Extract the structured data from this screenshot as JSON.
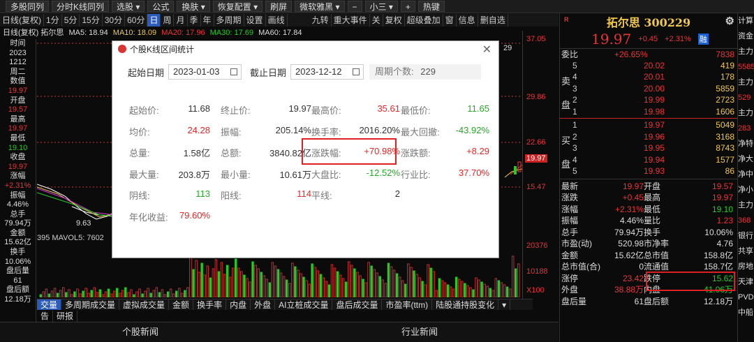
{
  "toolbar": {
    "items": [
      "多股同列",
      "分时K线同列",
      "选股 ▾",
      "公式",
      "换肤 ▾",
      "恢复配置 ▾",
      "刷屏",
      "微软雅黑 ▾",
      "−",
      "小三 ▾",
      "+",
      "热键"
    ]
  },
  "periods": {
    "items": [
      "日线(复权)",
      "1分",
      "5分",
      "15分",
      "30分",
      "60分",
      "日",
      "周",
      "月",
      "季",
      "年",
      "多周期",
      "设置",
      "画线",
      "九转",
      "重大事件",
      "关",
      "复权",
      "超级叠加",
      "窗",
      "信息",
      "删自选"
    ]
  },
  "ma_line": {
    "prefix": "日线(复权) 拓尔思",
    "ma5": "MA5: 18.94",
    "ma10": "MA10: 18.09",
    "ma20": "MA20: 17.96",
    "ma30": "MA30: 17.69",
    "ma60": "MA60: 17.84"
  },
  "left_panel": [
    {
      "t": "时间",
      "c": "#ddd"
    },
    {
      "t": "2023",
      "c": "#ddd"
    },
    {
      "t": "1212",
      "c": "#ddd"
    },
    {
      "t": "周二",
      "c": "#ddd"
    },
    {
      "t": "数值",
      "c": "#ddd"
    },
    {
      "t": "19.97",
      "c": "#e33"
    },
    {
      "t": "开盘",
      "c": "#ddd"
    },
    {
      "t": "19.57",
      "c": "#e33"
    },
    {
      "t": "最高",
      "c": "#ddd"
    },
    {
      "t": "19.97",
      "c": "#e33"
    },
    {
      "t": "最低",
      "c": "#ddd"
    },
    {
      "t": "19.10",
      "c": "#2c2"
    },
    {
      "t": "收盘",
      "c": "#ddd"
    },
    {
      "t": "19.97",
      "c": "#e33"
    },
    {
      "t": "涨幅",
      "c": "#ddd"
    },
    {
      "t": "+2.31%",
      "c": "#e33"
    },
    {
      "t": "振幅",
      "c": "#ddd"
    },
    {
      "t": "4.46%",
      "c": "#ddd"
    },
    {
      "t": "总手",
      "c": "#ddd"
    },
    {
      "t": "79.94万",
      "c": "#ddd"
    },
    {
      "t": "金额",
      "c": "#ddd"
    },
    {
      "t": "15.62亿",
      "c": "#ddd"
    },
    {
      "t": "换手",
      "c": "#ddd"
    },
    {
      "t": "10.06%",
      "c": "#ddd"
    },
    {
      "t": "盘后量",
      "c": "#ddd"
    },
    {
      "t": "61",
      "c": "#ddd"
    },
    {
      "t": "盘后额",
      "c": "#ddd"
    },
    {
      "t": "12.18万",
      "c": "#ddd"
    }
  ],
  "chart": {
    "low_label": "9.63",
    "mavol_label": "395  MAVOL5: 7602",
    "right_tag": "29",
    "price_tag": "19.97"
  },
  "scale": {
    "price": [
      "37.05",
      "29.86",
      "22.66",
      "15.47"
    ],
    "volume": [
      "20376",
      "10188",
      "X100"
    ]
  },
  "bottom_tabs": [
    "交量",
    "多周期成交量",
    "虚拟成交量",
    "金额",
    "换手率",
    "内盘",
    "外盘",
    "AI立桩成交量",
    "盘后成交量",
    "市盈率(ttm)",
    "陆股通持股变化",
    "▾"
  ],
  "bottom_tabs2": [
    "告",
    "研报"
  ],
  "news": {
    "left": "个股新闻",
    "right": "行业新闻"
  },
  "quote": {
    "title": "拓尔思 300229",
    "price": "19.97",
    "change": "+0.45",
    "pct": "+2.31%",
    "badge": "融",
    "weibi_label": "委比",
    "weibi": "+26.65%",
    "weicha": "7838",
    "sell": [
      {
        "n": "5",
        "p": "20.02",
        "v": "419"
      },
      {
        "n": "4",
        "p": "20.01",
        "v": "178"
      },
      {
        "n": "3",
        "p": "20.00",
        "v": "5859"
      },
      {
        "n": "2",
        "p": "19.99",
        "v": "2723"
      },
      {
        "n": "1",
        "p": "19.98",
        "v": "1606"
      }
    ],
    "buy": [
      {
        "n": "1",
        "p": "19.97",
        "v": "5049"
      },
      {
        "n": "2",
        "p": "19.96",
        "v": "3168"
      },
      {
        "n": "3",
        "p": "19.95",
        "v": "8743"
      },
      {
        "n": "4",
        "p": "19.94",
        "v": "1577"
      },
      {
        "n": "5",
        "p": "19.93",
        "v": "86"
      }
    ],
    "sell_side": "卖盘",
    "buy_side": "买盘",
    "stats": [
      [
        "最新",
        "19.97",
        "开盘",
        "19.57"
      ],
      [
        "涨跌",
        "+0.45",
        "最高",
        "19.97"
      ],
      [
        "涨幅",
        "+2.31%",
        "最低",
        "19.10"
      ],
      [
        "振幅",
        "4.46%",
        "量比",
        "1.23"
      ],
      [
        "总手",
        "79.94万",
        "换手",
        "10.06%"
      ],
      [
        "市盈(动)",
        "520.98",
        "市净率",
        "4.76"
      ],
      [
        "金额",
        "15.62亿",
        "总市值",
        "158.8亿"
      ],
      [
        "总市值(合)",
        "0",
        "流通值",
        "158.7亿"
      ],
      [
        "涨停",
        "23.42",
        "跌停",
        "15.62"
      ],
      [
        "外盘",
        "38.88万",
        "内盘",
        "41.06万"
      ],
      [
        "盘后量",
        "61",
        "盘后额",
        "12.18万"
      ]
    ]
  },
  "far_right": [
    "计算",
    "资金",
    "主力",
    "5585",
    "主力",
    "529",
    "主力",
    "283",
    "净特",
    "净大",
    "净中",
    "净小",
    "主力",
    "368",
    "银行",
    "共享",
    "房地",
    "天津",
    "PVD",
    "中船"
  ],
  "dialog": {
    "title": "个股K线区间统计",
    "start_label": "起始日期",
    "start": "2023-01-03",
    "end_label": "截止日期",
    "end": "2023-12-12",
    "period_label": "周期个数:",
    "period": "229",
    "rows": [
      [
        [
          "起始价:",
          "11.68",
          ""
        ],
        [
          "终止价:",
          "19.97",
          ""
        ],
        [
          "最高价:",
          "35.61",
          "red"
        ],
        [
          "最低价:",
          "11.65",
          "grn"
        ]
      ],
      [
        [
          "均价:",
          "24.28",
          "red"
        ],
        [
          "振幅:",
          "205.14%",
          ""
        ],
        [
          "换手率:",
          "2016.20%",
          ""
        ],
        [
          "最大回撤:",
          "-43.92%",
          "grn"
        ]
      ],
      [
        [
          "总量:",
          "1.58亿",
          ""
        ],
        [
          "总额:",
          "3840.82亿",
          ""
        ],
        [
          "涨跌幅:",
          "+70.98%",
          "red"
        ],
        [
          "涨跌额:",
          "+8.29",
          "red"
        ]
      ],
      [
        [
          "最大量:",
          "203.8万",
          ""
        ],
        [
          "最小量:",
          "10.61万",
          ""
        ],
        [
          "大盘比:",
          "-12.52%",
          "grn"
        ],
        [
          "行业比:",
          "37.70%",
          "red"
        ]
      ],
      [
        [
          "阴线:",
          "113",
          "grn"
        ],
        [
          "阳线:",
          "114",
          "red"
        ],
        [
          "平线:",
          "2",
          ""
        ],
        [
          "",
          "",
          ""
        ]
      ],
      [
        [
          "年化收益:",
          "79.60%",
          "red"
        ],
        [
          "",
          "",
          ""
        ],
        [
          "",
          "",
          ""
        ],
        [
          "",
          "",
          ""
        ]
      ]
    ]
  }
}
